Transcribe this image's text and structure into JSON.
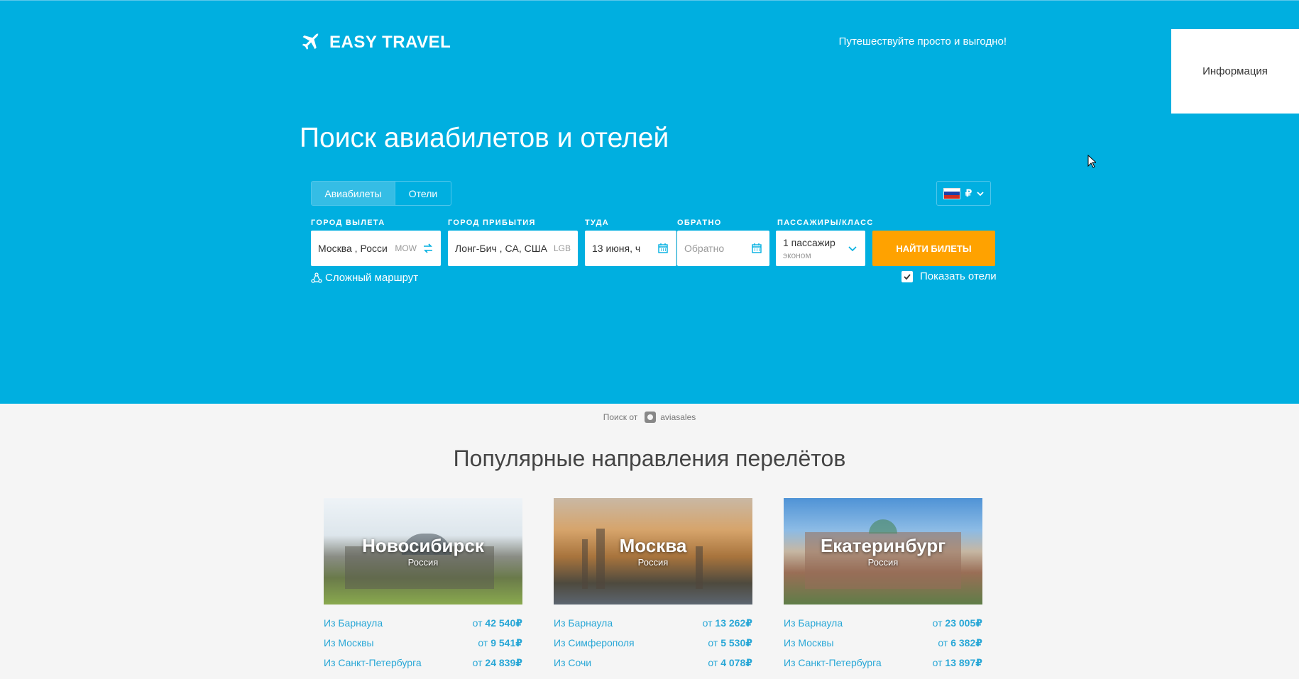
{
  "header": {
    "logo_text": "EASY TRAVEL",
    "tagline": "Путешествуйте просто и выгодно!",
    "info_label": "Информация"
  },
  "hero": {
    "title": "Поиск авиабилетов и отелей",
    "tabs": [
      {
        "label": "Авиабилеты",
        "active": true
      },
      {
        "label": "Отели",
        "active": false
      }
    ],
    "currency_symbol": "₽"
  },
  "form": {
    "origin_label": "ГОРОД ВЫЛЕТА",
    "origin_value": "Москва , Росси",
    "origin_code": "MOW",
    "destination_label": "ГОРОД ПРИБЫТИЯ",
    "destination_value": "Лонг-Бич , CA, США",
    "destination_code": "LGB",
    "depart_label": "ТУДА",
    "depart_value": "13 июня, ч",
    "return_label": "ОБРАТНО",
    "return_placeholder": "Обратно",
    "pax_label": "ПАССАЖИРЫ/КЛАСС",
    "pax_value": "1 пассажир",
    "pax_class": "эконом",
    "search_button": "НАЙТИ БИЛЕТЫ",
    "complex_route": "Сложный маршрут",
    "show_hotels": "Показать отели"
  },
  "powered": {
    "prefix": "Поиск от",
    "brand": "aviasales"
  },
  "popular": {
    "title": "Популярные направления перелётов",
    "cards": [
      {
        "city": "Новосибирск",
        "country": "Россия",
        "rows": [
          {
            "from": "Из Барнаула",
            "prefix": "от",
            "price": "42 540",
            "cur": "₽"
          },
          {
            "from": "Из Москвы",
            "prefix": "от",
            "price": "9 541",
            "cur": "₽"
          },
          {
            "from": "Из Санкт-Петербурга",
            "prefix": "от",
            "price": "24 839",
            "cur": "₽"
          }
        ]
      },
      {
        "city": "Москва",
        "country": "Россия",
        "rows": [
          {
            "from": "Из Барнаула",
            "prefix": "от",
            "price": "13 262",
            "cur": "₽"
          },
          {
            "from": "Из Симферополя",
            "prefix": "от",
            "price": "5 530",
            "cur": "₽"
          },
          {
            "from": "Из Сочи",
            "prefix": "от",
            "price": "4 078",
            "cur": "₽"
          }
        ]
      },
      {
        "city": "Екатеринбург",
        "country": "Россия",
        "rows": [
          {
            "from": "Из Барнаула",
            "prefix": "от",
            "price": "23 005",
            "cur": "₽"
          },
          {
            "from": "Из Москвы",
            "prefix": "от",
            "price": "6 382",
            "cur": "₽"
          },
          {
            "from": "Из Санкт-Петербурга",
            "prefix": "от",
            "price": "13 897",
            "cur": "₽"
          }
        ]
      }
    ]
  },
  "colors": {
    "hero_bg": "#00afe0",
    "accent": "#ffa200",
    "link": "#29a7d6"
  }
}
